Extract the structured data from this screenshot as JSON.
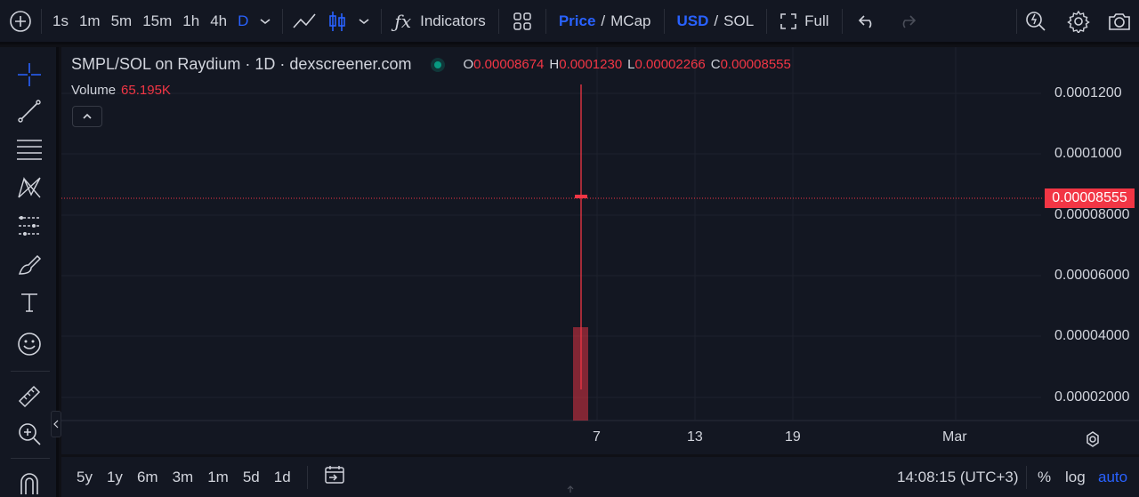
{
  "toolbar": {
    "timeframes": [
      "1s",
      "1m",
      "5m",
      "15m",
      "1h",
      "4h",
      "D"
    ],
    "active_timeframe": "D",
    "indicators_label": "Indicators",
    "price_label": "Price",
    "mcap_label": "MCap",
    "usd_label": "USD",
    "sol_label": "SOL",
    "full_label": "Full",
    "separator": "/"
  },
  "legend": {
    "title": "SMPL/SOL on Raydium · 1D · dexscreener.com",
    "o_key": "O",
    "o_val": "0.00008674",
    "h_key": "H",
    "h_val": "0.0001230",
    "l_key": "L",
    "l_val": "0.00002266",
    "c_key": "C",
    "c_val": "0.00008555",
    "volume_label": "Volume",
    "volume_value": "65.195K"
  },
  "price_axis": {
    "labels": [
      "0.0001200",
      "0.0001000",
      "0.00008000",
      "0.00006000",
      "0.00004000",
      "0.00002000"
    ],
    "current_price": "0.00008555"
  },
  "time_axis": {
    "labels": [
      "7",
      "13",
      "19",
      "Mar"
    ]
  },
  "bottombar": {
    "ranges": [
      "5y",
      "1y",
      "6m",
      "3m",
      "1m",
      "5d",
      "1d"
    ],
    "clock": "14:08:15 (UTC+3)",
    "percent_label": "%",
    "log_label": "log",
    "auto_label": "auto"
  },
  "colors": {
    "accent": "#2962ff",
    "down": "#f23645",
    "live_dot": "#089981"
  }
}
